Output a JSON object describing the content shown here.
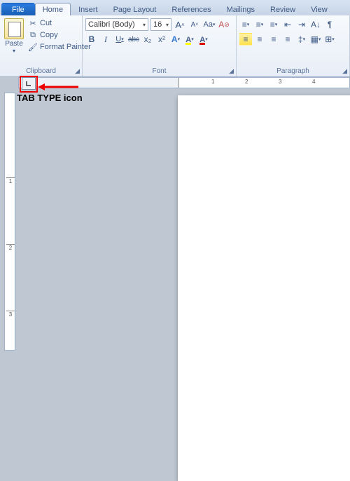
{
  "tabs": {
    "file": "File",
    "home": "Home",
    "insert": "Insert",
    "pagelayout": "Page Layout",
    "references": "References",
    "mailings": "Mailings",
    "review": "Review",
    "view": "View"
  },
  "clipboard": {
    "paste": "Paste",
    "cut": "Cut",
    "copy": "Copy",
    "formatpainter": "Format Painter",
    "label": "Clipboard"
  },
  "font": {
    "name": "Calibri (Body)",
    "size": "16",
    "grow": "A",
    "shrink": "A",
    "case": "Aa",
    "clear": "A",
    "bold": "B",
    "italic": "I",
    "underline": "U",
    "strike": "abc",
    "sub": "x₂",
    "sup": "x²",
    "fx": "A",
    "highlight": "A",
    "color": "A",
    "label": "Font"
  },
  "paragraph": {
    "label": "Paragraph"
  },
  "annotation": "TAB TYPE icon"
}
